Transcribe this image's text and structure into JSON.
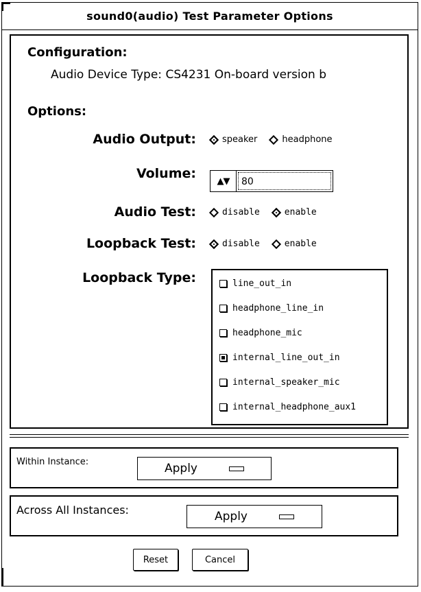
{
  "window": {
    "title": "sound0(audio) Test Parameter Options"
  },
  "configuration": {
    "heading": "Configuration:",
    "device_type_line": "Audio Device Type: CS4231 On-board version b"
  },
  "options": {
    "heading": "Options:",
    "audio_output": {
      "label": "Audio Output:",
      "choices": [
        {
          "label": "speaker",
          "selected": true
        },
        {
          "label": "headphone",
          "selected": false
        }
      ]
    },
    "volume": {
      "label": "Volume:",
      "value": "80",
      "arrows": "▲▼"
    },
    "audio_test": {
      "label": "Audio Test:",
      "choices": [
        {
          "label": "disable",
          "selected": false
        },
        {
          "label": "enable",
          "selected": true
        }
      ]
    },
    "loopback_test": {
      "label": "Loopback Test:",
      "choices": [
        {
          "label": "disable",
          "selected": true
        },
        {
          "label": "enable",
          "selected": false
        }
      ]
    },
    "loopback_type": {
      "label": "Loopback Type:",
      "items": [
        {
          "label": "line_out_in",
          "checked": false
        },
        {
          "label": "headphone_line_in",
          "checked": false
        },
        {
          "label": "headphone_mic",
          "checked": false
        },
        {
          "label": "internal_line_out_in",
          "checked": true
        },
        {
          "label": "internal_speaker_mic",
          "checked": false
        },
        {
          "label": "internal_headphone_aux1",
          "checked": false
        }
      ]
    }
  },
  "within_instance": {
    "label": "Within Instance:",
    "button": "Apply"
  },
  "across_instances": {
    "label": "Across All Instances:",
    "button": "Apply"
  },
  "buttons": {
    "reset": "Reset",
    "cancel": "Cancel"
  }
}
